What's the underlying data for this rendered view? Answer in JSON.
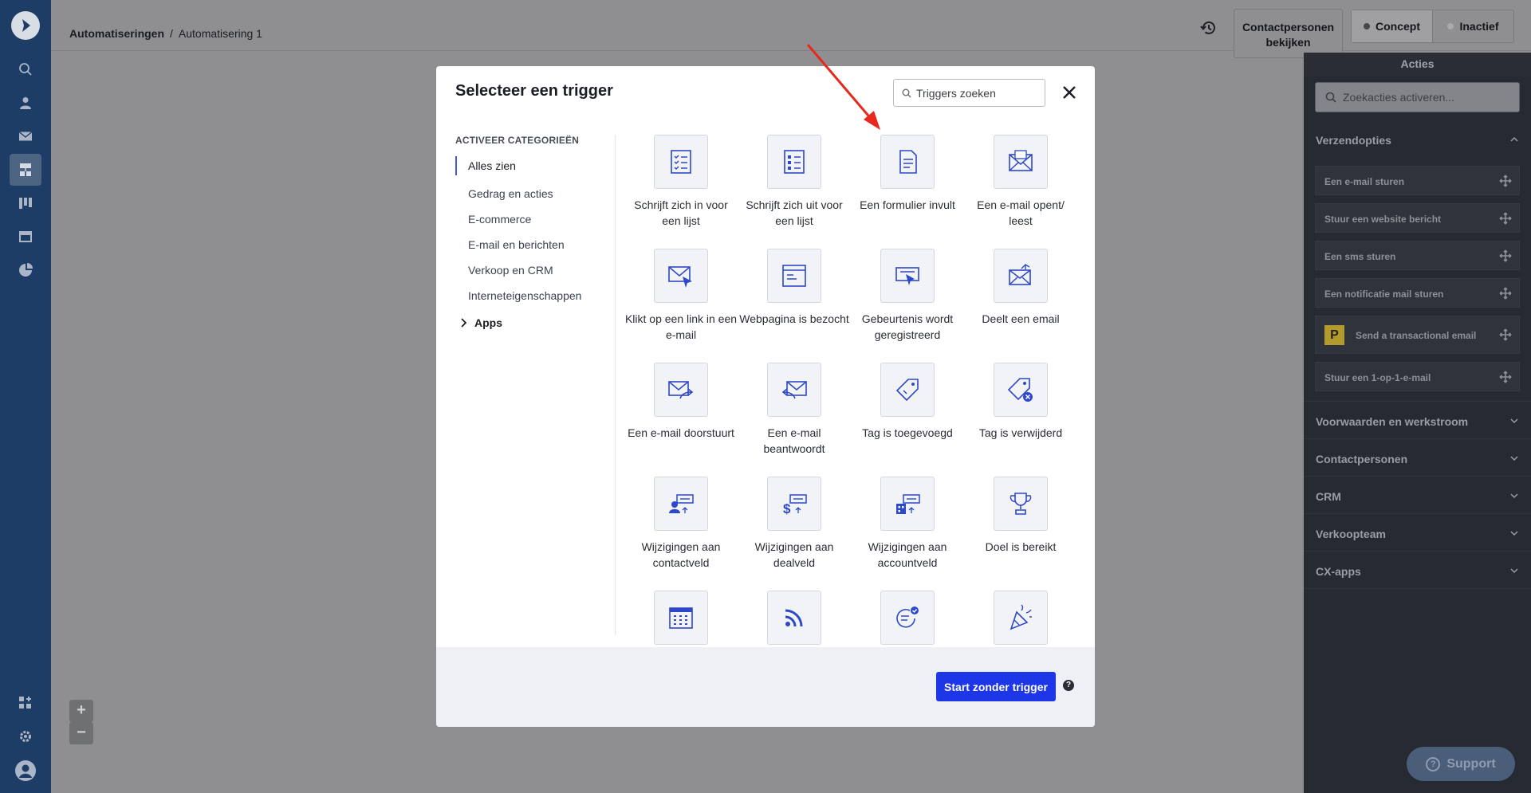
{
  "header": {
    "breadcrumb_root": "Automatiseringen",
    "breadcrumb_current": "Automatisering 1",
    "contacts_button": "Contactpersonen bekijken",
    "status_concept": "Concept",
    "status_inactive": "Inactief"
  },
  "actions_panel": {
    "title": "Acties",
    "search_placeholder": "Zoekacties activeren...",
    "send_section": "Verzendopties",
    "items": [
      "Een e-mail sturen",
      "Stuur een website bericht",
      "Een sms sturen",
      "Een notificatie mail sturen",
      "Send a transactional email",
      "Stuur een 1-op-1-e-mail"
    ],
    "badge_letter": "P",
    "sections": [
      "Voorwaarden en werkstroom",
      "Contactpersonen",
      "CRM",
      "Verkoopteam",
      "CX-apps"
    ]
  },
  "modal": {
    "title": "Selecteer een trigger",
    "search_placeholder": "Triggers zoeken",
    "categories_heading": "ACTIVEER CATEGORIEËN",
    "categories": [
      "Alles zien",
      "Gedrag en acties",
      "E-commerce",
      "E-mail en berichten",
      "Verkoop en CRM",
      "Interneteigenschappen"
    ],
    "apps_label": "Apps",
    "triggers": [
      {
        "label": "Schrijft zich in voor een lijst",
        "icon": "list-subscribe-icon"
      },
      {
        "label": "Schrijft zich uit voor een lijst",
        "icon": "list-unsubscribe-icon"
      },
      {
        "label": "Een formulier invult",
        "icon": "form-icon"
      },
      {
        "label": "Een e-mail opent/ leest",
        "icon": "email-open-icon"
      },
      {
        "label": "Klikt op een link in een e-mail",
        "icon": "email-click-icon"
      },
      {
        "label": "Webpagina is bezocht",
        "icon": "webpage-icon"
      },
      {
        "label": "Gebeurtenis wordt geregistreerd",
        "icon": "event-icon"
      },
      {
        "label": "Deelt een email",
        "icon": "email-share-icon"
      },
      {
        "label": "Een e-mail doorstuurt",
        "icon": "email-forward-icon"
      },
      {
        "label": "Een e-mail beantwoordt",
        "icon": "email-reply-icon"
      },
      {
        "label": "Tag is toegevoegd",
        "icon": "tag-added-icon"
      },
      {
        "label": "Tag is verwijderd",
        "icon": "tag-removed-icon"
      },
      {
        "label": "Wijzigingen aan contactveld",
        "icon": "contact-field-icon"
      },
      {
        "label": "Wijzigingen aan dealveld",
        "icon": "deal-field-icon"
      },
      {
        "label": "Wijzigingen aan accountveld",
        "icon": "account-field-icon"
      },
      {
        "label": "Doel is bereikt",
        "icon": "trophy-icon"
      },
      {
        "label": "",
        "icon": "calendar-icon"
      },
      {
        "label": "",
        "icon": "rss-icon"
      },
      {
        "label": "",
        "icon": "message-check-icon"
      },
      {
        "label": "",
        "icon": "party-icon"
      }
    ],
    "start_button": "Start zonder trigger",
    "help_glyph": "?"
  },
  "zoom": {
    "plus": "+",
    "minus": "−"
  },
  "support": {
    "label": "Support",
    "glyph": "?"
  },
  "colors": {
    "primary": "#1c36e8",
    "nav": "#1e3d66",
    "icon_blue": "#2d48c8",
    "annotation_arrow": "#e8281c"
  }
}
